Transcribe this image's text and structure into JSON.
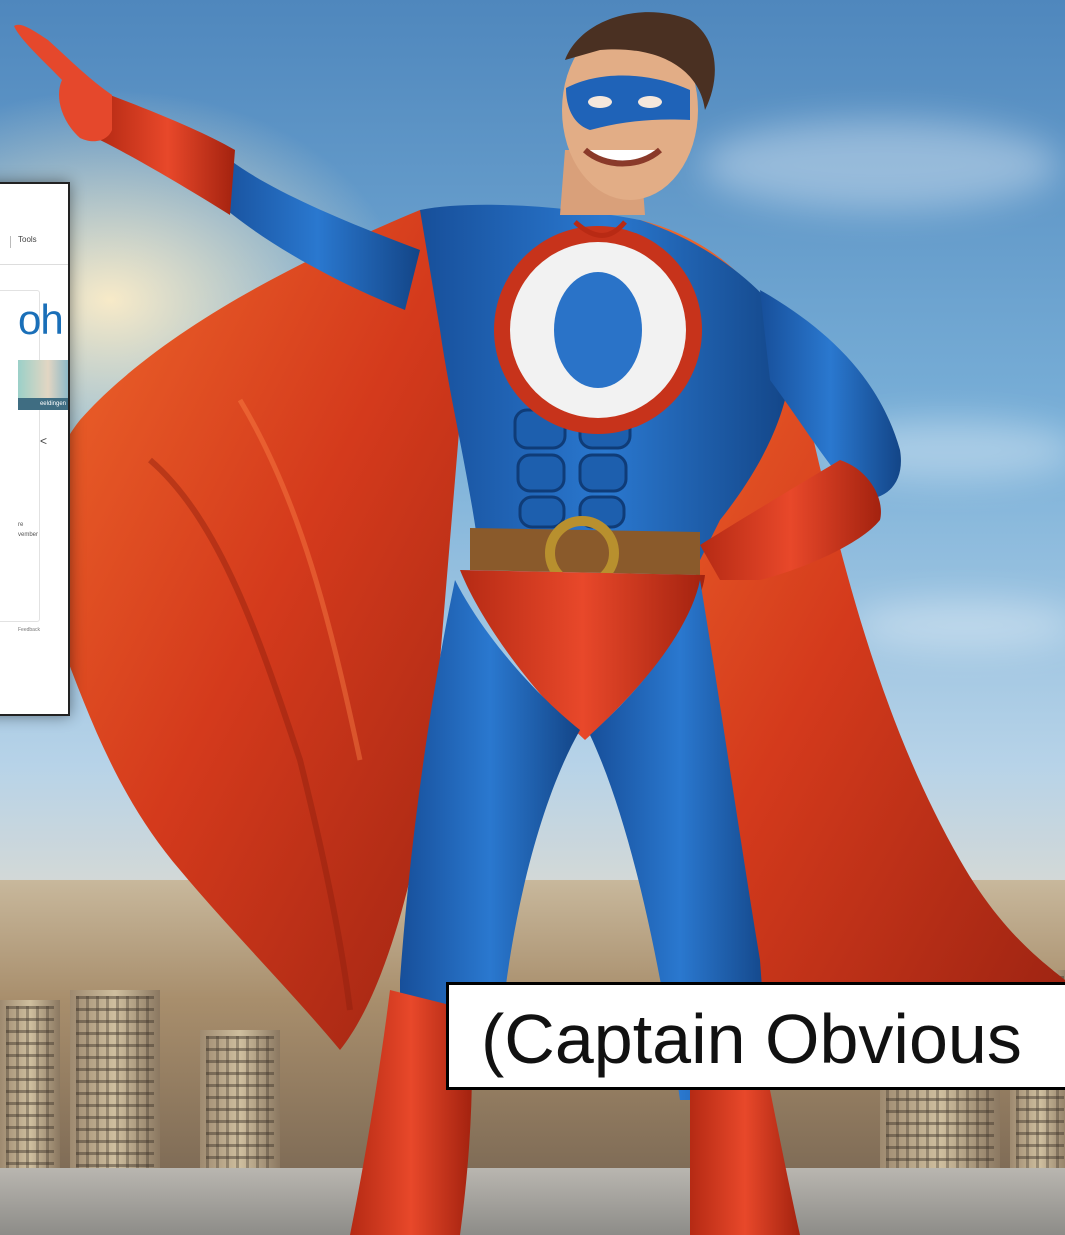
{
  "screenshot_card": {
    "tools_label": "Tools",
    "big_text": "oh",
    "banner_label": "eeldingen",
    "share_icon": "share-icon",
    "line_1": "re",
    "line_2": "vember",
    "feedback": "Feedback"
  },
  "caption": {
    "text": "(Captain Obvious"
  },
  "colors": {
    "suit_blue": "#1f63b8",
    "cape_red": "#d43a1c",
    "emblem_white": "#f2f2f2",
    "belt_brown": "#8a5a2b"
  }
}
